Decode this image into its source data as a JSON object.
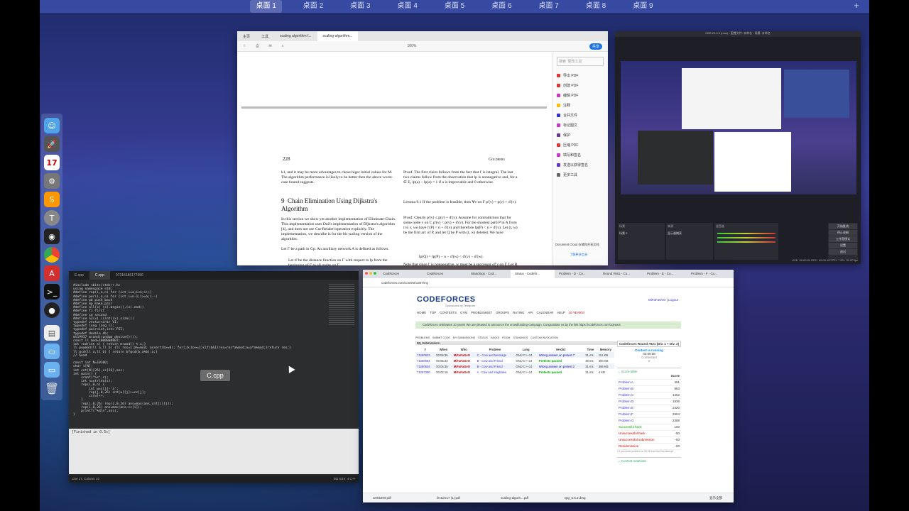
{
  "spaces": [
    "桌面 1",
    "桌面 2",
    "桌面 3",
    "桌面 4",
    "桌面 5",
    "桌面 6",
    "桌面 7",
    "桌面 8",
    "桌面 9"
  ],
  "spaces_active": 0,
  "plus": "+",
  "dock_icons": [
    "finder-icon",
    "launchpad-icon",
    "calendar-icon",
    "system-preferences-icon",
    "sublime-text-icon",
    "tex-icon",
    "qq-icon",
    "chrome-icon",
    "acrobat-icon",
    "terminal-icon",
    "obs-icon",
    "document-icon",
    "folder-icon",
    "folder-icon-2",
    "trash-icon"
  ],
  "calendar_day": "17",
  "pdf": {
    "tabs": [
      "主页",
      "工具",
      "scaling algorithm f...",
      "scaling-algorithm..."
    ],
    "page_num": "228",
    "page_header": "Goldberg",
    "left_col_top": "k1, and it may be more advantages to chose higer initial values for M. The algorithm performance is likely to be better then the above worst-case bound suggests.",
    "section_num": "9",
    "section_title": "Chain Elimination Using Dijkstra's Algorithm",
    "left_col_body": "In this section we show yet another implementation of Eliminate-Chain. This implementation uses Dail's implementation of Dijkstra's algorithm [4], and does not use Cut-Relabel operation explicitly. The implementation, we describe is for the bit scaling version of the algorithm.",
    "left_col_p2": "Let Γ be a path in Gp. An auxiliary network A is defined as follows.",
    "bullet1": "Let d' be the distance function on Γ with respect to lp from the beginning of Γ to all nodes on Γ.",
    "bullet2": "Define f(a) = max(0, l_p(a)).",
    "proof": "Proof. The first claim follows from the fact that l' is integral. The last two claims follow from the observation that lp is nonnegative and, for a ∈ E, lp(a) − lp(a) = 1 if a is improvable and 0 otherwise.",
    "lemma": "Lemma 9.1 If the problem is feasible, then ∀v on Γ p'(v) = p(v) + d'(v).",
    "proof2": "Proof. Clearly p'(v) ≤ p(v) + d'(v). Assume for contradiction that for some node v on Γ, p'(v) < p(v) + d'(v). For the shortest path P in A from t to v, we have l'(P) < n + d'(v) and therefore lp(P) < n + d'(v). Let (t, w) be the first arc of P, and let Q be P with (t, w) deleted. We have",
    "formula": "lp(Q) = lp(P) − n − d'(w) < d'(v) − d'(w).",
    "proof3": "Note that since l' is nonnegative, w must be a successor of v on Γ. Let R be the part of Γ between v and w. By the definition of d',",
    "sidebar": [
      "导出 PDF",
      "创建 PDF",
      "编辑 PDF",
      "注释",
      "合并文件",
      "标记图文",
      "保护",
      "压缩 PDF",
      "填写和签名",
      "发送以获得签名",
      "更多工具"
    ],
    "search_placeholder": "搜索 '更改工具'",
    "share": "共享",
    "cloud": "Document Cloud 存储和共享文档",
    "learn": "了解更多信息",
    "zoom": "100%"
  },
  "sublime": {
    "tabs": [
      "E.cpp",
      "C.cpp",
      "07315186177056"
    ],
    "title": "Untitled - C.cpp",
    "code": "#include <bits/stdc++.h>\nusing namespace std;\n#define rep(i,a,n) for (int i=a;i<n;i++)\n#define per(i,a,n) for (int i=n-1;i>=a;i--)\n#define pb push_back\n#define mp make_pair\n#define all(x) (x).begin(),(x).end()\n#define fi first\n#define se second\n#define SZ(x) ((int)(x).size())\ntypedef vector<int> VI;\ntypedef long long ll;\ntypedef pair<int,int> PII;\ntypedef double db;\nmt19937 mrand(random_device{}());\nconst ll mod=1000000007;\nint rnd(int x) { return mrand() % x;}\nll powmod(ll a,ll b) {ll res=1;a%=mod; assert(b>=0); for(;b;b>>=1){if(b&1)res=res*a%mod;a=a*a%mod;}return res;}\nll gcd(ll a,ll b) { return b?gcd(b,a%b):a;}\n// head\n\nconst int N=10100;\nchar s[N];\nint cnt[N][26],cc[26],ans;\nint main() {\n    scanf(\"%s\",s);\n    int n=strlen(s);\n    rep(i,0,n) {\n        int w=s[i]-'a';\n        rep(j,0,26) cnt[w][j]+=cc[j];\n        cc[w]++;\n    }\n    rep(i,0,26) rep(j,0,26) ans=max(ans,cnt[i][j]);\n    rep(i,0,26) ans=max(ans,cc[i]);\n    printf(\"%d\\n\",ans);\n}\n",
    "console": "[Finished in 0.5s]",
    "status_left": "Line 17, Column 10",
    "status_right": "Tab Size: 4     C++",
    "tooltip": "C.cpp"
  },
  "obs": {
    "title": "OBS 22.0.3 (mac) - 配置文件: 未命名 - 场景: 未命名",
    "scene_label": "场景",
    "source_label": "来源",
    "scene_item": "场景 2",
    "source_item": "显示器捕获",
    "mixer_label": "混音器",
    "controls": [
      "开始推流",
      "停止录制",
      "工作室模式",
      "设置",
      "退出"
    ],
    "status": "LIVE: 00:00:00    REC: 00:00:18    CPU: 7.6%, 30.00 fps"
  },
  "browser": {
    "tabs": [
      "Codeforces",
      "Codeforces",
      "Standings - Cod...",
      "Status - Codefo...",
      "Problem - D - Co...",
      "Round #561 - Co...",
      "Problem - E - Co...",
      "Problem - F - Co...",
      "Problem - 3 - Co..."
    ],
    "active_tab": 3,
    "url": "codeforces.com/contest/1307/my",
    "logo": "CODEFORCES",
    "sponsored": "Sponsored by Telegram",
    "user": "MiFaFaOvO | Logout",
    "nav": [
      "HOME",
      "TOP",
      "CONTESTS",
      "GYM",
      "PROBLEMSET",
      "GROUPS",
      "RATING",
      "API",
      "CALENDAR",
      "HELP",
      "10 YEARS!"
    ],
    "banner": "Codeforces celebrates 10 years! We are pleased to announce the crowdfunding-campaign. Congratulate us by the link https://codeforces.com/10years",
    "subnav": [
      "PROBLEMS",
      "SUBMIT CODE",
      "MY SUBMISSIONS",
      "STATUS",
      "HACKS",
      "ROOM",
      "STANDINGS",
      "CUSTOM INVOCATION"
    ],
    "my_submissions": "My Submissions",
    "headers": [
      "#",
      "When",
      "Who",
      "Problem",
      "Lang",
      "Verdict",
      "Time",
      "Memory"
    ],
    "rows": [
      [
        "71280823",
        "00:06:36",
        "MiFaFaOvO",
        "C - Cow and Message",
        "GNU C++14",
        "Wrong answer on pretest 7",
        "31 ms",
        "112 KB"
      ],
      [
        "71280654",
        "00:05:33",
        "MiFaFaOvO",
        "B - Cow and Friend",
        "GNU C++14",
        "Pretests passed",
        "46 ms",
        "400 KB"
      ],
      [
        "71280634",
        "00:04:35",
        "MiFaFaOvO",
        "B - Cow and Friend",
        "GNU C++14",
        "Wrong answer on pretest 2",
        "31 ms",
        "356 KB"
      ],
      [
        "71287390",
        "00:02:18",
        "MiFaFaOvO",
        "A - Cow and Haybales",
        "GNU C++14",
        "Pretests passed",
        "31 ms",
        "4 KB"
      ]
    ],
    "contest_title": "Codeforces Round #621 (Div. 1 + Div. 2)",
    "contest_running": "Contest is running",
    "timer": "02:06:08",
    "contestant": "Contestant",
    "score_table": "→ Score table",
    "score_header": "Score",
    "scores": [
      [
        "Problem A",
        "491"
      ],
      [
        "Problem B",
        "983"
      ],
      [
        "Problem C",
        "1452"
      ],
      [
        "Problem D",
        "1936"
      ],
      [
        "Problem E",
        "2420"
      ],
      [
        "Problem F",
        "2904"
      ],
      [
        "Problem G",
        "2388"
      ],
      [
        "Successful hack",
        "100"
      ],
      [
        "Unsuccessful hack",
        "-50"
      ],
      [
        "Unsuccessful submission",
        "-50"
      ],
      [
        "Resubmission",
        "-50"
      ]
    ],
    "score_note": "* If you solve problem on 00:06 from the first attempt",
    "contest_materials": "→ Contest materials",
    "downloads": [
      "C004290.pdf",
      "lecture17 (1).pdf",
      "scaling-algorit....pdf",
      "QQ_6.6.3.dmg"
    ],
    "show_all": "显示全部"
  }
}
